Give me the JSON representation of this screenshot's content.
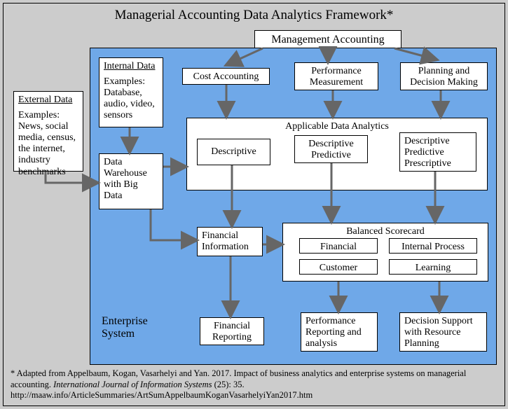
{
  "title": "Managerial Accounting Data Analytics Framework*",
  "external": {
    "heading": "External Data",
    "body": "Examples: News, social media, census, the internet, industry benchmarks"
  },
  "internal": {
    "heading": "Internal Data",
    "body": "Examples: Database, audio, video, sensors"
  },
  "warehouse": "Data Warehouse with Big Data",
  "mgmt": "Management Accounting",
  "cost": "Cost Accounting",
  "perf_meas": "Performance Measurement",
  "plan": "Planning and Decision Making",
  "ada": {
    "title": "Applicable Data Analytics",
    "d": "Descriptive",
    "dp": "Descriptive Predictive",
    "dpp": "Descriptive Predictive Prescriptive"
  },
  "fininfo": "Financial Information",
  "bsc": {
    "title": "Balanced Scorecard",
    "fin": "Financial",
    "ip": "Internal Process",
    "cust": "Customer",
    "learn": "Learning"
  },
  "finrep": "Financial Reporting",
  "perfrep": "Performance Reporting and analysis",
  "decsup": "Decision Support with Resource Planning",
  "entlabel": "Enterprise System",
  "footnote": {
    "line1": "* Adapted from Appelbaum, Kogan, Vasarhelyi and Yan.  2017.  Impact of business analytics and enterprise systems on managerial accounting.  ",
    "journal": "International Journal of Information Systems",
    "line2": " (25): 35. http://maaw.info/ArticleSummaries/ArtSumAppelbaumKoganVasarhelyiYan2017.htm"
  }
}
